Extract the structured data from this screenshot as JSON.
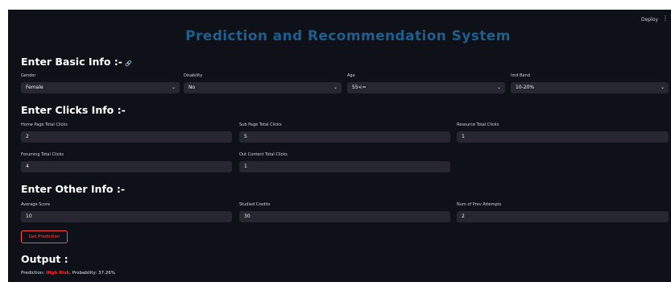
{
  "header": {
    "deploy_label": "Deploy",
    "menu_icon": "⋮"
  },
  "title": "Prediction and Recommendation System",
  "basic_info": {
    "heading": "Enter Basic Info :-",
    "link_icon": "🔗",
    "fields": [
      {
        "label": "Gender",
        "value": "Female"
      },
      {
        "label": "Disability",
        "value": "No"
      },
      {
        "label": "Age",
        "value": "55<="
      },
      {
        "label": "Imd Band",
        "value": "10-20%"
      }
    ]
  },
  "clicks_info": {
    "heading": "Enter Clicks Info :-",
    "fields": [
      {
        "label": "Home Page Total Clicks",
        "value": "2"
      },
      {
        "label": "Sub Page Total Clicks",
        "value": "5"
      },
      {
        "label": "Resource Total Clicks",
        "value": "1"
      },
      {
        "label": "Foruming Total Clicks",
        "value": "4"
      },
      {
        "label": "Out Content Total Clicks",
        "value": "1"
      }
    ]
  },
  "other_info": {
    "heading": "Enter Other Info :-",
    "fields": [
      {
        "label": "Average Score",
        "value": "10"
      },
      {
        "label": "Studied Credits",
        "value": "30"
      },
      {
        "label": "Num of Prev Attempts",
        "value": "2"
      }
    ]
  },
  "predict_button_label": "Get Prediction",
  "output": {
    "heading": "Output :",
    "prediction_label": "Prediction: ",
    "prediction_value": "High Risk",
    "probability_text": ", Probability: 37.26%"
  },
  "colors": {
    "background": "#0e1117",
    "title": "#1e5f8f",
    "input_bg": "#262730",
    "accent_red": "#ff4b4b"
  }
}
